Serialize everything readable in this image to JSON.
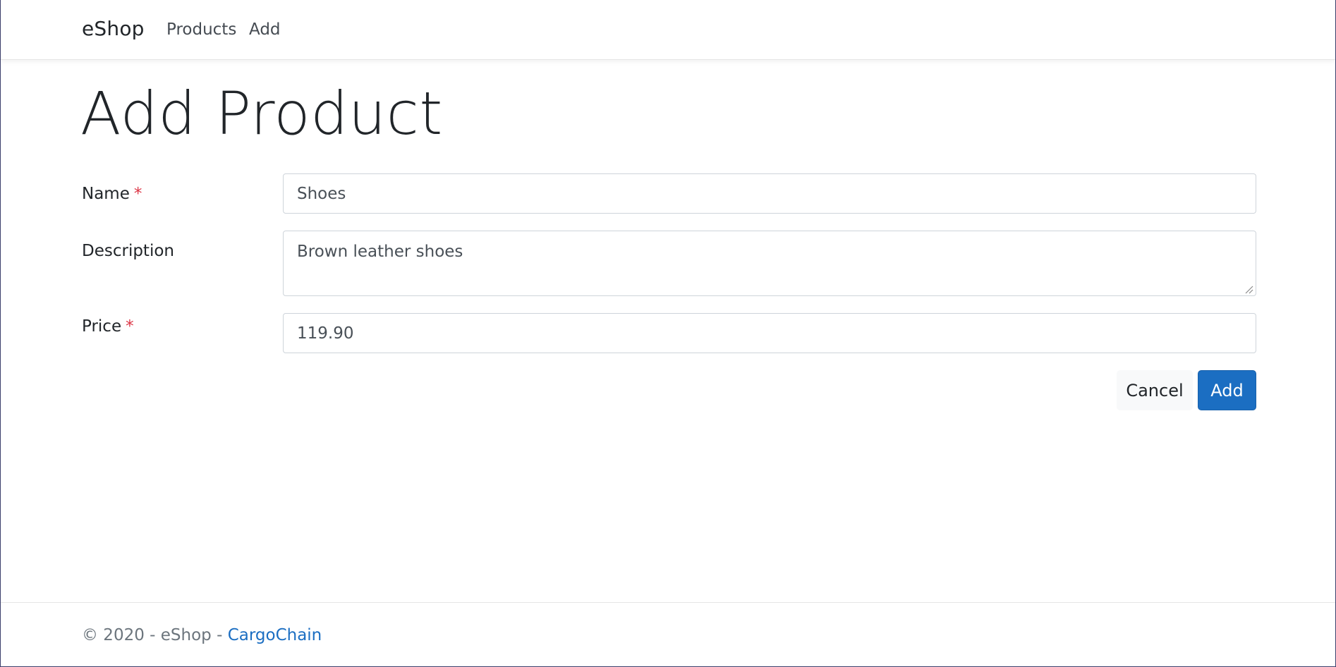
{
  "navbar": {
    "brand": "eShop",
    "links": [
      {
        "label": "Products"
      },
      {
        "label": "Add"
      }
    ]
  },
  "page": {
    "title": "Add Product"
  },
  "form": {
    "name": {
      "label": "Name",
      "required_marker": "*",
      "value": "Shoes"
    },
    "description": {
      "label": "Description",
      "value": "Brown leather shoes"
    },
    "price": {
      "label": "Price",
      "required_marker": "*",
      "value": "119.90"
    },
    "buttons": {
      "cancel": "Cancel",
      "submit": "Add"
    }
  },
  "footer": {
    "text": "© 2020 - eShop - ",
    "link": "CargoChain"
  },
  "colors": {
    "primary": "#1b6ec2",
    "required": "#dc3545",
    "muted": "#6c757d"
  }
}
